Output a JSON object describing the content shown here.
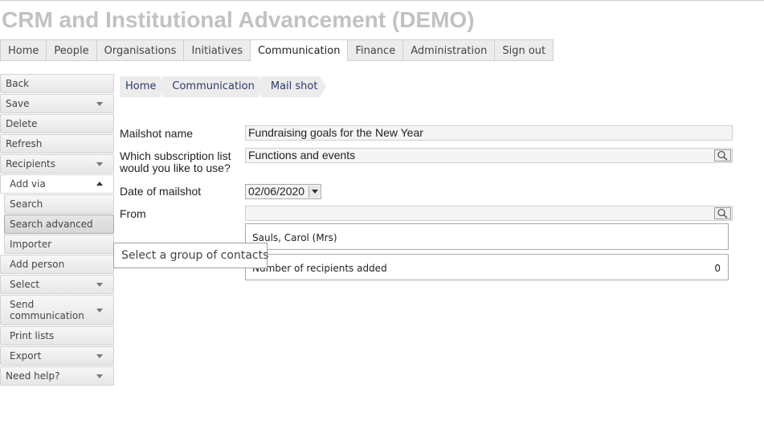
{
  "app": {
    "title": "CRM and Institutional Advancement (DEMO)"
  },
  "topnav": {
    "items": [
      "Home",
      "People",
      "Organisations",
      "Initiatives",
      "Communication",
      "Finance",
      "Administration",
      "Sign out"
    ],
    "active": "Communication"
  },
  "sidebar": {
    "back": "Back",
    "save": "Save",
    "delete": "Delete",
    "refresh": "Refresh",
    "recipients": "Recipients",
    "add_via": "Add via",
    "search": "Search",
    "search_advanced": "Search advanced",
    "importer": "Importer",
    "add_person": "Add person",
    "select": "Select",
    "send_communication": "Send communication",
    "print_lists": "Print lists",
    "export": "Export",
    "need_help": "Need help?"
  },
  "breadcrumb": [
    "Home",
    "Communication",
    "Mail shot"
  ],
  "form": {
    "mailshot_name_label": "Mailshot name",
    "mailshot_name_value": "Fundraising goals for the New Year",
    "subscription_label": "Which subscription list would you like to use?",
    "subscription_value": "Functions and events",
    "date_label": "Date of mailshot",
    "date_value": "02/06/2020",
    "from_label": "From",
    "from_value": ""
  },
  "recipients": {
    "added_person": "Sauls, Carol (Mrs)",
    "count_label": "Number of recipients added",
    "count_value": "0"
  },
  "tooltip": {
    "text": "Select a group of contacts"
  }
}
